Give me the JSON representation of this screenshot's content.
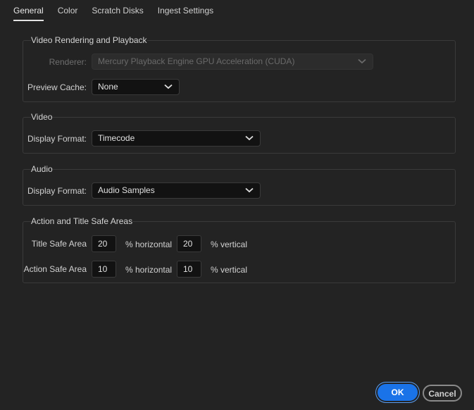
{
  "tabs": [
    {
      "label": "General",
      "active": true
    },
    {
      "label": "Color",
      "active": false
    },
    {
      "label": "Scratch Disks",
      "active": false
    },
    {
      "label": "Ingest Settings",
      "active": false
    }
  ],
  "video_rendering": {
    "title": "Video Rendering and Playback",
    "renderer_label": "Renderer:",
    "renderer_value": "Mercury Playback Engine GPU Acceleration (CUDA)",
    "preview_cache_label": "Preview Cache:",
    "preview_cache_value": "None"
  },
  "video": {
    "title": "Video",
    "display_format_label": "Display Format:",
    "display_format_value": "Timecode"
  },
  "audio": {
    "title": "Audio",
    "display_format_label": "Display Format:",
    "display_format_value": "Audio Samples"
  },
  "safe_areas": {
    "title": "Action and Title Safe Areas",
    "title_safe_label": "Title Safe Area",
    "title_safe_horizontal": "20",
    "title_safe_vertical": "20",
    "action_safe_label": "Action Safe Area",
    "action_safe_horizontal": "10",
    "action_safe_vertical": "10",
    "horizontal_unit": "% horizontal",
    "vertical_unit": "% vertical"
  },
  "buttons": {
    "ok_label": "OK",
    "cancel_label": "Cancel"
  },
  "colors": {
    "background": "#232323",
    "accent": "#1a73e8"
  }
}
